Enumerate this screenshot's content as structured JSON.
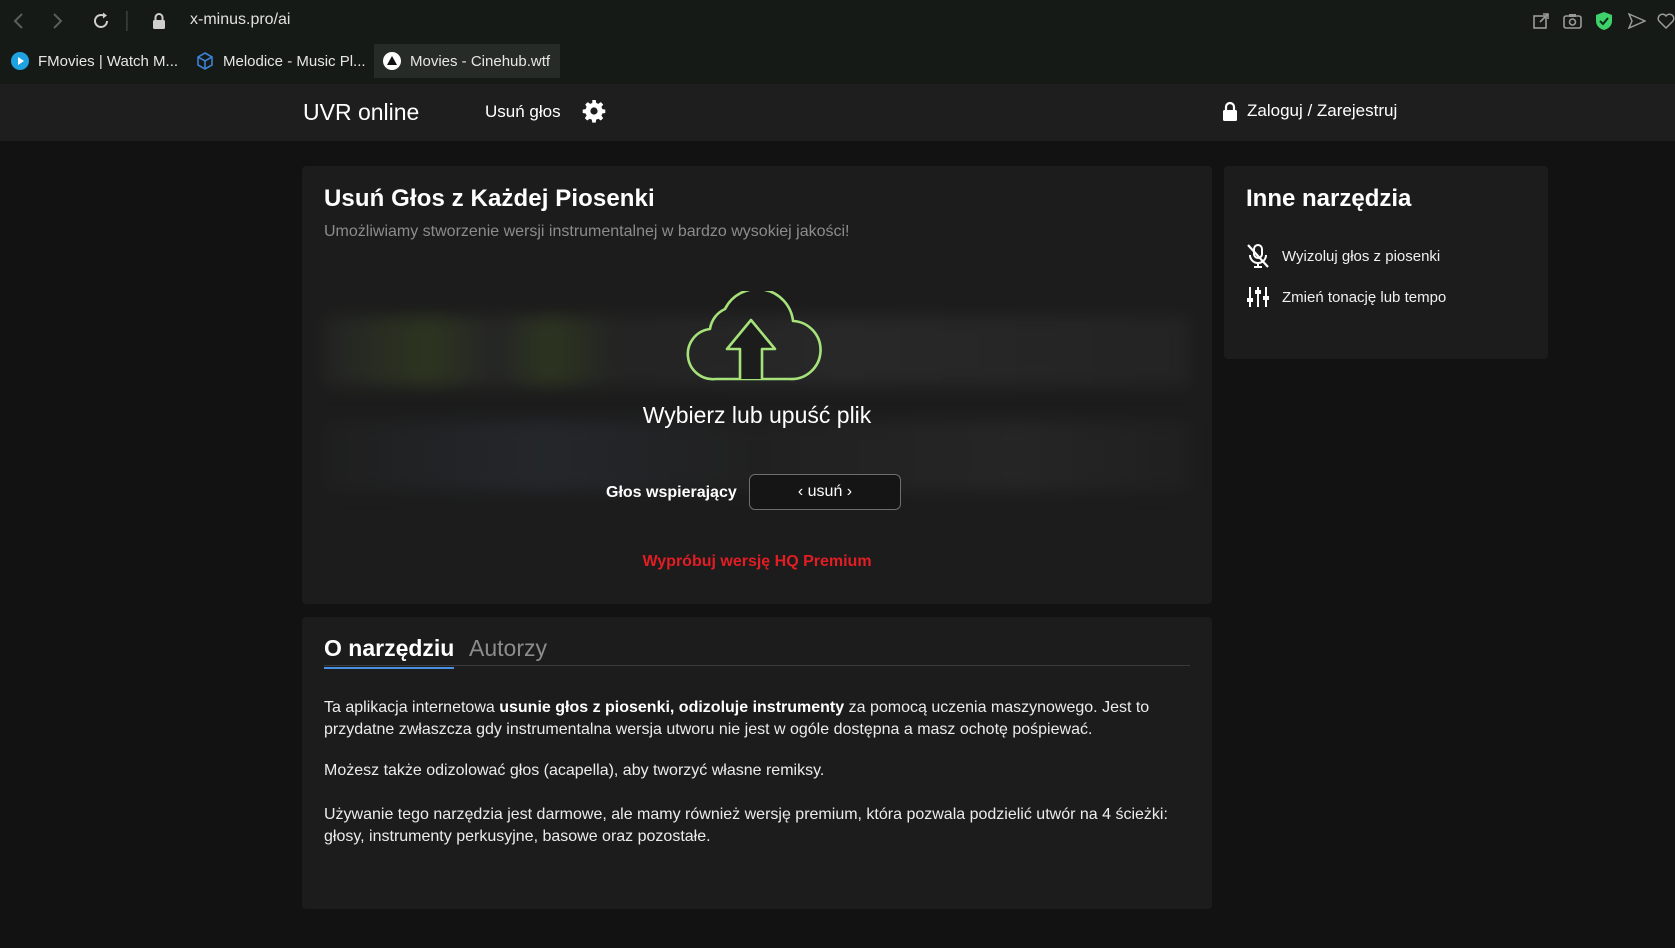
{
  "browser": {
    "url": "x-minus.pro/ai",
    "tabs": [
      {
        "label": "FMovies | Watch M...",
        "icon": "play-circle-icon",
        "active": false
      },
      {
        "label": "Melodice - Music Pl...",
        "icon": "cube-icon",
        "active": false
      },
      {
        "label": "Movies - Cinehub.wtf",
        "icon": "triangle-icon",
        "active": true
      }
    ]
  },
  "header": {
    "brand": "UVR online",
    "nav_remove": "Usuń głos",
    "login": "Zaloguj / Zarejestruj"
  },
  "main": {
    "title": "Usuń Głos z Każdej Piosenki",
    "subtitle": "Umożliwiamy stworzenie wersji instrumentalnej w bardzo wysokiej jakości!",
    "drop_text": "Wybierz lub upuść plik",
    "backing_vocal_label": "Głos wspierający",
    "backing_vocal_value": "‹ usuń ›",
    "premium_link": "Wypróbuj wersję HQ Premium"
  },
  "side": {
    "title": "Inne narzędzia",
    "items": [
      {
        "label": "Wyizoluj głos z piosenki",
        "icon": "mic-off-icon"
      },
      {
        "label": "Zmień tonację lub tempo",
        "icon": "sliders-icon"
      }
    ]
  },
  "about": {
    "tab_about": "O narzędziu",
    "tab_authors": "Autorzy",
    "p1_start": "Ta aplikacja internetowa ",
    "p1_bold": "usunie głos z piosenki, odizoluje instrumenty",
    "p1_end": " za pomocą uczenia maszynowego. Jest to przydatne zwłaszcza gdy instrumentalna wersja utworu nie jest w ogóle dostępna a masz ochotę pośpiewać.",
    "p2": "Możesz także odizolować głos (acapella), aby tworzyć własne remiksy.",
    "p3": "Używanie tego narzędzia jest darmowe, ale mamy również wersję premium, która pozwala podzielić utwór na 4 ścieżki: głosy, instrumenty perkusyjne, basowe oraz pozostałe."
  },
  "colors": {
    "accent_green": "#a6e27a",
    "premium_red": "#e21d23",
    "tab_underline": "#4a90e2"
  }
}
